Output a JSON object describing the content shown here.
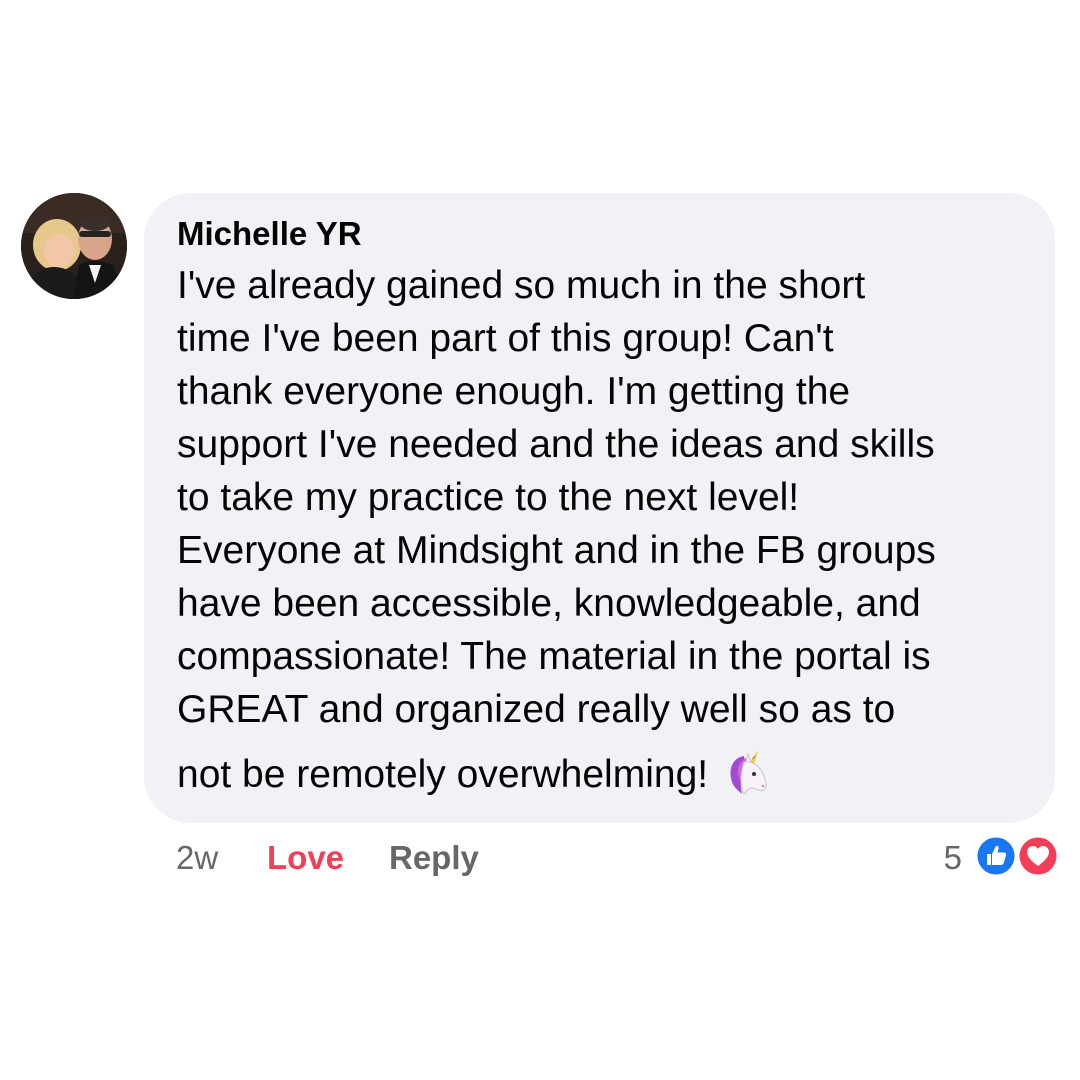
{
  "comment": {
    "author": "Michelle YR",
    "lines": [
      "I've already gained so much in the short",
      "time I've been part of this group! Can't",
      "thank everyone enough. I'm getting the",
      "support I've needed and the ideas and skills",
      "to take my practice to the next level!",
      "Everyone at Mindsight and in the FB groups",
      "have been accessible, knowledgeable, and",
      "compassionate! The material in the portal is",
      "GREAT and organized really well so as to"
    ],
    "last_line": "not be remotely overwhelming!",
    "emoji": "unicorn-icon"
  },
  "actions": {
    "time": "2w",
    "love_label": "Love",
    "reply_label": "Reply"
  },
  "reactions": {
    "count": "5",
    "types": [
      "like-icon",
      "heart-icon"
    ]
  },
  "colors": {
    "bubble": "#f0f2f5",
    "text": "#050505",
    "muted": "#65676b",
    "love": "#f33e58",
    "like_blue": "#1877f2",
    "heart_red": "#f33e58"
  }
}
